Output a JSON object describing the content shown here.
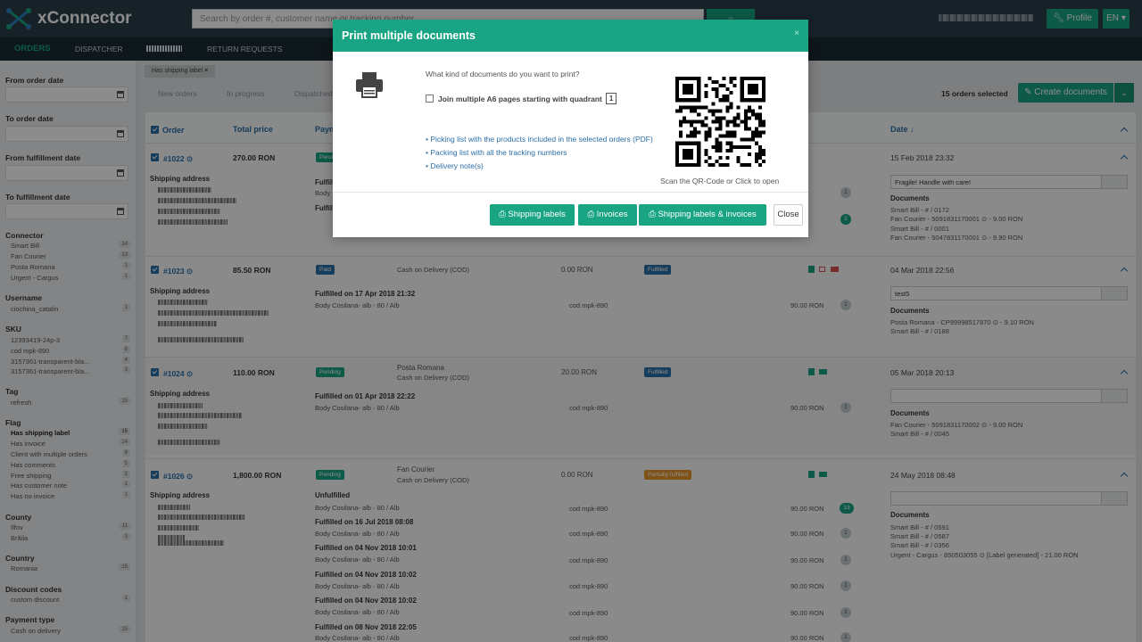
{
  "app": {
    "name": "xConnector"
  },
  "header": {
    "search_placeholder": "Search by order #, customer name or tracking number",
    "profile_label": "Profile",
    "lang_label": "EN"
  },
  "nav": {
    "orders": "ORDERS",
    "dispatcher": "DISPATCHER",
    "returns": "RETURN REQUESTS"
  },
  "sidebar": {
    "from_order_date": "From order date",
    "to_order_date": "To order date",
    "from_fulfillment_date": "From fulfillment date",
    "to_fulfillment_date": "To fulfillment date",
    "connector": {
      "title": "Connector",
      "items": [
        {
          "label": "Smart Bill",
          "count": "14"
        },
        {
          "label": "Fan Courier",
          "count": "13"
        },
        {
          "label": "Posta Romana",
          "count": "1"
        },
        {
          "label": "Urgent - Cargus",
          "count": "1"
        }
      ]
    },
    "username": {
      "title": "Username",
      "items": [
        {
          "label": "ciochina_catalin",
          "count": "1"
        }
      ]
    },
    "sku": {
      "title": "SKU",
      "items": [
        {
          "label": "12393419-24p-3",
          "count": "7"
        },
        {
          "label": "cod mpk-890",
          "count": "8"
        },
        {
          "label": "3157361-transparent-bla...",
          "count": "4"
        },
        {
          "label": "3157361-transparent-bla...",
          "count": "3"
        }
      ]
    },
    "tag": {
      "title": "Tag",
      "items": [
        {
          "label": "refresh",
          "count": "15"
        }
      ]
    },
    "flag": {
      "title": "Flag",
      "items": [
        {
          "label": "Has shipping label",
          "count": "15"
        },
        {
          "label": "Has invoice",
          "count": "14"
        },
        {
          "label": "Client with multiple orders",
          "count": "6"
        },
        {
          "label": "Has comments",
          "count": "5"
        },
        {
          "label": "Free shipping",
          "count": "2"
        },
        {
          "label": "Has customer note",
          "count": "1"
        },
        {
          "label": "Has no invoice",
          "count": "1"
        }
      ]
    },
    "county": {
      "title": "County",
      "items": [
        {
          "label": "Ilfov",
          "count": "11"
        },
        {
          "label": "Brăila",
          "count": "3"
        }
      ]
    },
    "country": {
      "title": "Country",
      "items": [
        {
          "label": "Romania",
          "count": "15"
        }
      ]
    },
    "discount": {
      "title": "Discount codes",
      "items": [
        {
          "label": "custom discount",
          "count": "1"
        }
      ]
    },
    "payment": {
      "title": "Payment type",
      "items": [
        {
          "label": "Cash on delivery",
          "count": "15"
        }
      ]
    }
  },
  "filter_chip": "Has shipping label",
  "tabs": [
    "New orders",
    "In progress",
    "Dispatched"
  ],
  "selection": {
    "count_label": "15 orders selected",
    "create_label": "Create documents"
  },
  "table": {
    "headers": {
      "order": "Order",
      "total": "Total price",
      "payment": "Paym",
      "date": "Date"
    }
  },
  "orders": [
    {
      "id": "#1022",
      "total": "270.00 RON",
      "status": "Pend",
      "shipping_address": "Shipping address",
      "fulfilled": "Fulfill",
      "fulfilled2": "Fulfill",
      "product": "Body",
      "date": "15 Feb 2018 23:32",
      "note": "Fragile! Handle with care!",
      "docs_title": "Documents",
      "docs": [
        "Smart Bill - # / 0172",
        "Fan Courier - 5091831170001 ⊙ - 9.00 RON",
        "Smart Bill - # / 0001",
        "Fan Courier - 5047831170001 ⊙ - 9.90 RON"
      ],
      "count1": "1",
      "count2": "2"
    },
    {
      "id": "#1023",
      "total": "85.50 RON",
      "status": "Paid",
      "payment": "Cash on Delivery (COD)",
      "paid": "0.00 RON",
      "fstatus": "Fulfilled",
      "shipping_address": "Shipping address",
      "fulfilled": "Fulfilled on 17 Apr 2018 21:32",
      "product": "Body Cosilana- alb - 80 / Alb",
      "sku": "cod mpk-890",
      "price": "90.00 RON",
      "qty": "1",
      "date": "04 Mar 2018 22:56",
      "note": "test5",
      "docs_title": "Documents",
      "docs": [
        "Posta Romana - CP99998517870 ⊙ - 9.10 RON",
        "Smart Bill - # / 0188"
      ]
    },
    {
      "id": "#1024",
      "total": "110.00 RON",
      "status": "Pending",
      "courier": "Posta Romana",
      "payment": "Cash on Delivery (COD)",
      "paid": "20.00 RON",
      "fstatus": "Fulfilled",
      "shipping_address": "Shipping address",
      "fulfilled": "Fulfilled on 01 Apr 2018 22:22",
      "product": "Body Cosilana- alb - 80 / Alb",
      "sku": "cod mpk-890",
      "price": "90.00 RON",
      "qty": "1",
      "date": "05 Mar 2018 20:13",
      "note": "",
      "docs_title": "Documents",
      "docs": [
        "Fan Courier - 5091831170002 ⊙ - 9.00 RON",
        "Smart Bill - # / 0045"
      ]
    },
    {
      "id": "#1026",
      "total": "1,800.00 RON",
      "status": "Pending",
      "courier": "Fan Courier",
      "payment": "Cash on Delivery (COD)",
      "paid": "0.00 RON",
      "fstatus": "Partially fulfilled",
      "shipping_address": "Shipping address",
      "date": "24 May 2018 08:48",
      "note": "",
      "docs_title": "Documents",
      "docs": [
        "Smart Bill - # / 0591",
        "Smart Bill - # / 0587",
        "Smart Bill - # / 0356",
        "Urgent - Cargus - 850503055 ⊙ [Label generated] - 21.00 RON"
      ],
      "lines": [
        {
          "head": "Unfulfilled",
          "product": "Body Cosilana- alb - 80 / Alb",
          "sku": "cod mpk-890",
          "price": "90.00 RON",
          "qty": "13"
        },
        {
          "head": "Fulfilled on 16 Jul 2018 08:08",
          "product": "Body Cosilana- alb - 80 / Alb",
          "sku": "cod mpk-890",
          "price": "90.00 RON",
          "qty": "1"
        },
        {
          "head": "Fulfilled on 04 Nov 2018 10:01",
          "product": "Body Cosilana- alb - 80 / Alb",
          "sku": "cod mpk-890",
          "price": "90.00 RON",
          "qty": "1"
        },
        {
          "head": "Fulfilled on 04 Nov 2018 10:02",
          "product": "Body Cosilana- alb - 80 / Alb",
          "sku": "cod mpk-890",
          "price": "90.00 RON",
          "qty": "1"
        },
        {
          "head": "Fulfilled on 04 Nov 2018 10:02",
          "product": "Body Cosilana- alb - 80 / Alb",
          "sku": "cod mpk-890",
          "price": "90.00 RON",
          "qty": "1"
        },
        {
          "head": "Fulfilled on 08 Nov 2018 22:05",
          "product": "Body Cosilana- alb - 80 / Alb",
          "sku": "cod mpk-890",
          "price": "90.00 RON",
          "qty": "1"
        }
      ]
    }
  ],
  "modal": {
    "title": "Print multiple documents",
    "close_x": "×",
    "question": "What kind of documents do you want to print?",
    "join_label": "Join multiple A6 pages starting with quadrant",
    "join_value": "1",
    "options": [
      "• Picking list with the products included in the selected orders (PDF)",
      "• Packing list with all the tracking numbers",
      "• Delivery note(s)"
    ],
    "qr_caption": "Scan the QR-Code or Click to open",
    "buttons": {
      "shipping_labels": "Shipping labels",
      "invoices": "Invoices",
      "both": "Shipping labels & invoices",
      "close": "Close"
    }
  },
  "colors": {
    "accent": "#19a483",
    "header": "#2b3c4a",
    "link": "#2a6fa8",
    "partial": "#e8952b"
  }
}
